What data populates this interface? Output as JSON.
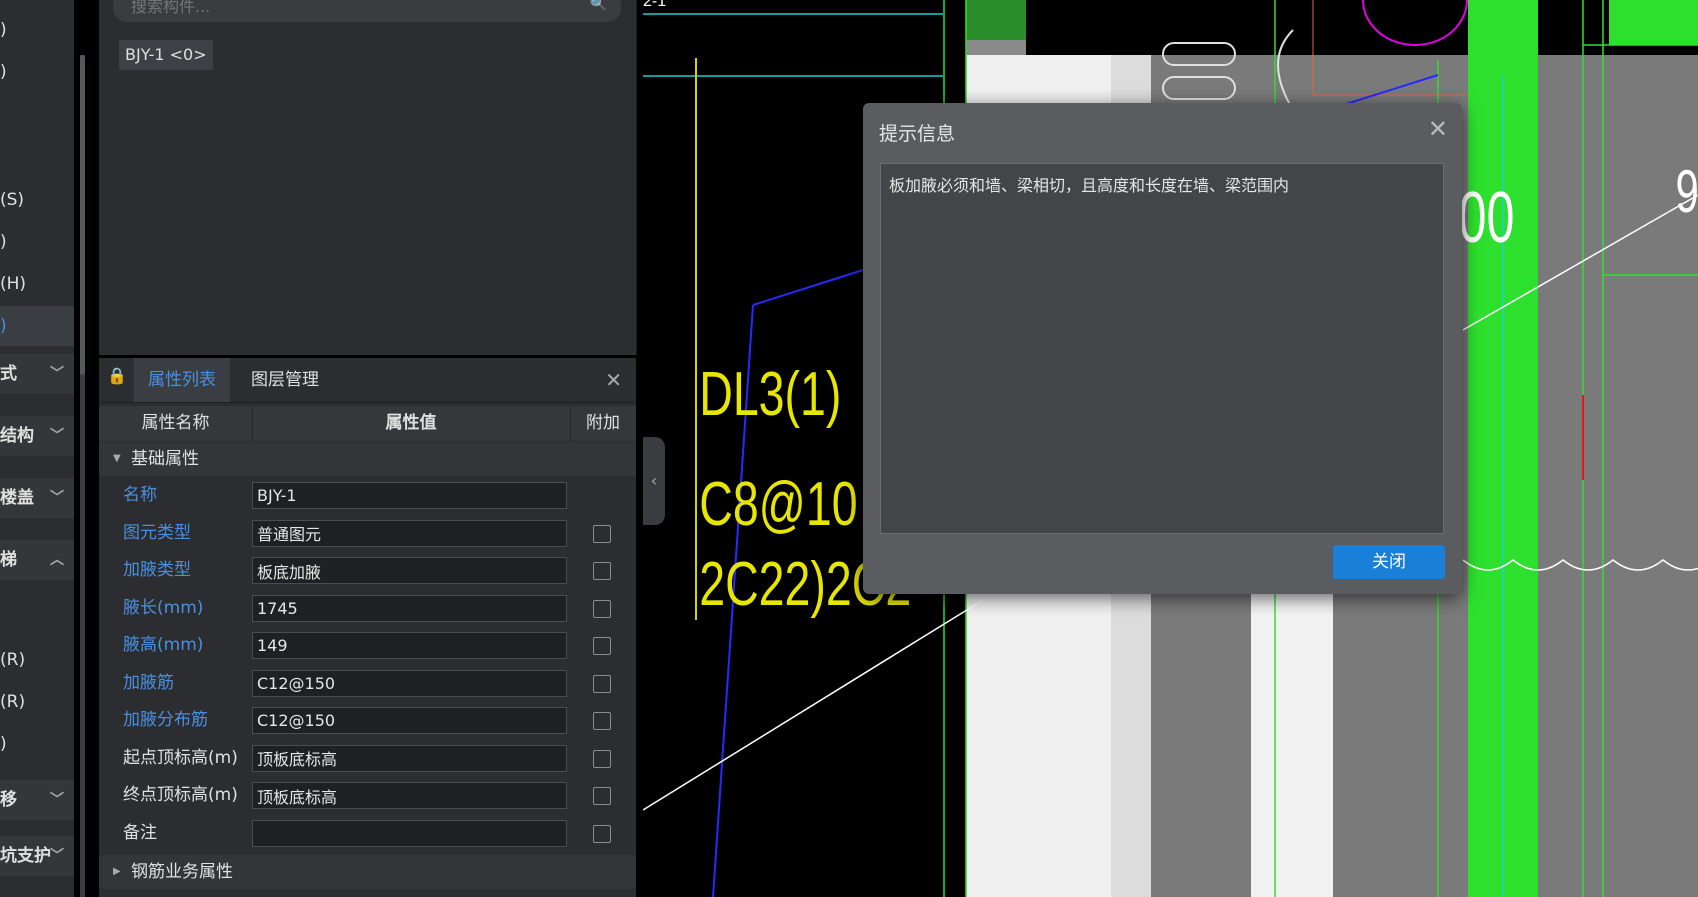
{
  "left_nav": {
    "items": [
      {
        "label": ")",
        "type": "item"
      },
      {
        "label": ")",
        "type": "item"
      },
      {
        "label": "(S)",
        "type": "item"
      },
      {
        "label": ")",
        "type": "item"
      },
      {
        "label": "(H)",
        "type": "item"
      },
      {
        "label": ")",
        "type": "selected"
      },
      {
        "label": "式",
        "type": "group",
        "chevron": "chevron-down"
      },
      {
        "label": "结构",
        "type": "group",
        "chevron": "chevron-down"
      },
      {
        "label": "楼盖",
        "type": "group",
        "chevron": "chevron-down"
      },
      {
        "label": "梯",
        "type": "group",
        "chevron": "chevron-up"
      },
      {
        "label": "(R)",
        "type": "item"
      },
      {
        "label": "(R)",
        "type": "item"
      },
      {
        "label": ")",
        "type": "item"
      },
      {
        "label": "移",
        "type": "group",
        "chevron": "chevron-down"
      },
      {
        "label": "坑支护",
        "type": "group",
        "chevron": "chevron-down"
      }
    ]
  },
  "component_panel": {
    "search_placeholder": "搜索构件...",
    "chip": "BJY-1 <0>"
  },
  "properties_panel": {
    "tabs": [
      {
        "label": "属性列表",
        "active": true
      },
      {
        "label": "图层管理",
        "active": false
      }
    ],
    "columns": {
      "name": "属性名称",
      "value": "属性值",
      "extra": "附加"
    },
    "section_basic": "基础属性",
    "rows": [
      {
        "name": "名称",
        "value": "BJY-1",
        "blue": true,
        "checkbox": false
      },
      {
        "name": "图元类型",
        "value": "普通图元",
        "blue": true,
        "checkbox": true
      },
      {
        "name": "加腋类型",
        "value": "板底加腋",
        "blue": true,
        "checkbox": true
      },
      {
        "name": "腋长(mm)",
        "value": "1745",
        "blue": true,
        "checkbox": true
      },
      {
        "name": "腋高(mm)",
        "value": "149",
        "blue": true,
        "checkbox": true
      },
      {
        "name": "加腋筋",
        "value": "C12@150",
        "blue": true,
        "checkbox": true
      },
      {
        "name": "加腋分布筋",
        "value": "C12@150",
        "blue": true,
        "checkbox": true
      },
      {
        "name": "起点顶标高(m)",
        "value": "顶板底标高",
        "blue": false,
        "checkbox": true
      },
      {
        "name": "终点顶标高(m)",
        "value": "顶板底标高",
        "blue": false,
        "checkbox": true
      },
      {
        "name": "备注",
        "value": "",
        "blue": false,
        "checkbox": true
      }
    ],
    "section_rebar": "钢筋业务属性"
  },
  "cad": {
    "labels": [
      "DL3(1)",
      "C8@10",
      "2C22)2C2",
      "2-1",
      "00",
      "9"
    ],
    "colors": {
      "yellow": "#e6e600",
      "green": "#2ee02e",
      "blue": "#2828ff",
      "magenta": "#e000e0"
    }
  },
  "dialog": {
    "title": "提示信息",
    "message": "板加腋必须和墙、梁相切，且高度和长度在墙、梁范围内",
    "close_button": "关闭"
  },
  "colors": {
    "accent": "#4a90e2",
    "button": "#1a7fd6",
    "panel": "#2b2d30"
  }
}
